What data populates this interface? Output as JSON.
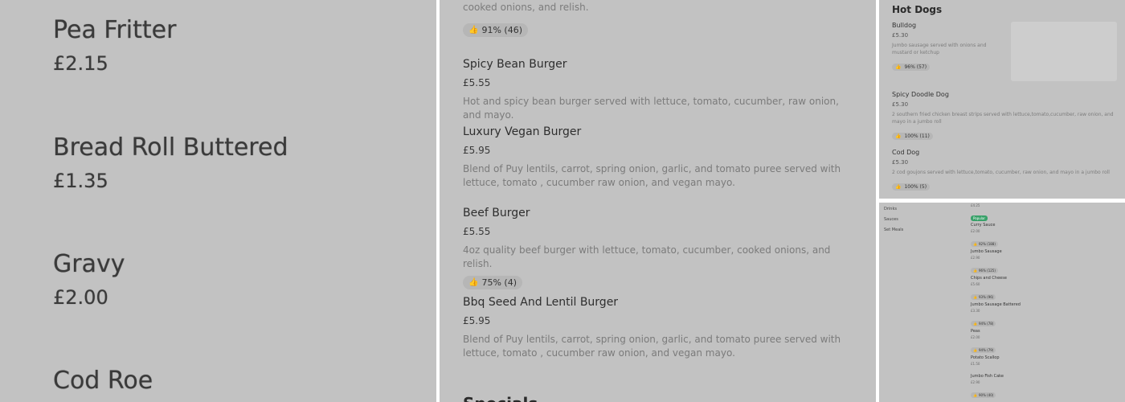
{
  "panel1": {
    "items": [
      {
        "name": "Pea Fritter",
        "price": "£2.15"
      },
      {
        "name": "Bread Roll Buttered",
        "price": "£1.35"
      },
      {
        "name": "Gravy",
        "price": "£2.00"
      },
      {
        "name": "Cod Roe",
        "price": ""
      }
    ]
  },
  "panel2": {
    "top_text": "cooked onions, and relish.",
    "top_rating": "91% (46)",
    "items": [
      {
        "name": "Spicy Bean Burger",
        "price": "£5.55",
        "description": "Hot and spicy bean burger served with lettuce, tomato, cucumber, raw onion, and mayo.",
        "rating": ""
      },
      {
        "name": "Luxury Vegan Burger",
        "price": "£5.95",
        "description": "Blend of Puy lentils, carrot, spring onion, garlic, and tomato puree served with lettuce, tomato , cucumber raw onion, and vegan mayo.",
        "rating": ""
      },
      {
        "name": "Beef Burger",
        "price": "£5.55",
        "description": "4oz quality beef burger with lettuce, tomato, cucumber, cooked onions, and relish.",
        "rating": "75% (4)"
      },
      {
        "name": "Bbq Seed And Lentil Burger",
        "price": "£5.95",
        "description": "Blend of Puy lentils, carrot, spring onion, garlic, and tomato puree served with lettuce, tomato , cucumber raw onion, and vegan mayo.",
        "rating": ""
      }
    ],
    "next_section": "Specials"
  },
  "panel3": {
    "title": "Hot Dogs",
    "items": [
      {
        "name": "Bulldog",
        "price": "£5.30",
        "description": "Jumbo sausage served with onions and mustard or ketchup",
        "rating": "96% (57)"
      },
      {
        "name": "Spicy Doodle Dog",
        "price": "£5.30",
        "description": "2 southern fried chicken breast strips served with lettuce,tomato,cucumber, raw onion, and mayo in a jumbo roll",
        "rating": "100% (11)"
      },
      {
        "name": "Cod Dog",
        "price": "£5.30",
        "description": "2 cod goujons served with lettuce,tomato, cucumber, raw onion, and mayo in a jumbo roll",
        "rating": "100% (5)"
      }
    ]
  },
  "panel4": {
    "categories": [
      "Drinks",
      "Sauces",
      "Set Meals"
    ],
    "top_price": "£4.25",
    "popular_label": "Popular",
    "items": [
      {
        "name": "Curry Sauce",
        "price": "£2.00",
        "rating": "92% (188)"
      },
      {
        "name": "Jumbo Sausage",
        "price": "£2.90",
        "rating": "96% (125)"
      },
      {
        "name": "Chips and Cheese",
        "price": "£5.60",
        "rating": "93% (96)"
      },
      {
        "name": "Jumbo Sausage Battered",
        "price": "£3.30",
        "rating": "94% (78)"
      },
      {
        "name": "Peas",
        "price": "£2.00",
        "rating": "94% (79)"
      },
      {
        "name": "Potato Scallop",
        "price": "£1.50",
        "rating": ""
      },
      {
        "name": "Jumbo Fish Cake",
        "price": "£2.90",
        "rating": "90% (40)"
      }
    ]
  },
  "colors": {
    "background": "#c2c2c2",
    "badge": "#b6b6b6",
    "popular": "#38a169"
  }
}
